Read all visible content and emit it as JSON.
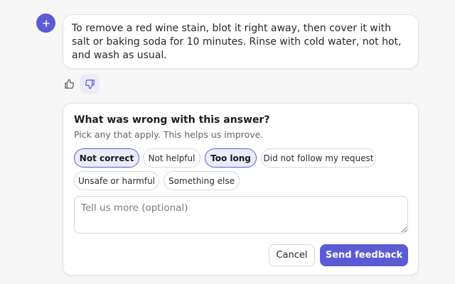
{
  "assistant": {
    "avatar_icon": "sparkle-plus-icon",
    "answer": "To remove a red wine stain, blot it right away, then cover it with salt or baking soda for 10 minutes. Rinse with cold water, not hot, and wash as usual."
  },
  "feedback_buttons": {
    "thumbs_up_icon": "thumbs-up-icon",
    "thumbs_down_icon": "thumbs-down-icon",
    "thumbs_down_active": true
  },
  "panel": {
    "title": "What was wrong with this answer?",
    "subtitle": "Pick any that apply. This helps us improve.",
    "chips": [
      {
        "label": "Not correct",
        "selected": true
      },
      {
        "label": "Not helpful",
        "selected": false
      },
      {
        "label": "Too long",
        "selected": true
      },
      {
        "label": "Did not follow my request",
        "selected": false
      },
      {
        "label": "Unsafe or harmful",
        "selected": false
      },
      {
        "label": "Something else",
        "selected": false
      }
    ],
    "details_placeholder": "Tell us more (optional)",
    "details_value": "",
    "cancel_label": "Cancel",
    "send_label": "Send feedback"
  },
  "colors": {
    "accent": "#5b5bd6",
    "chip_selected_bg": "#ebebfb",
    "background": "#f7f7f8"
  }
}
